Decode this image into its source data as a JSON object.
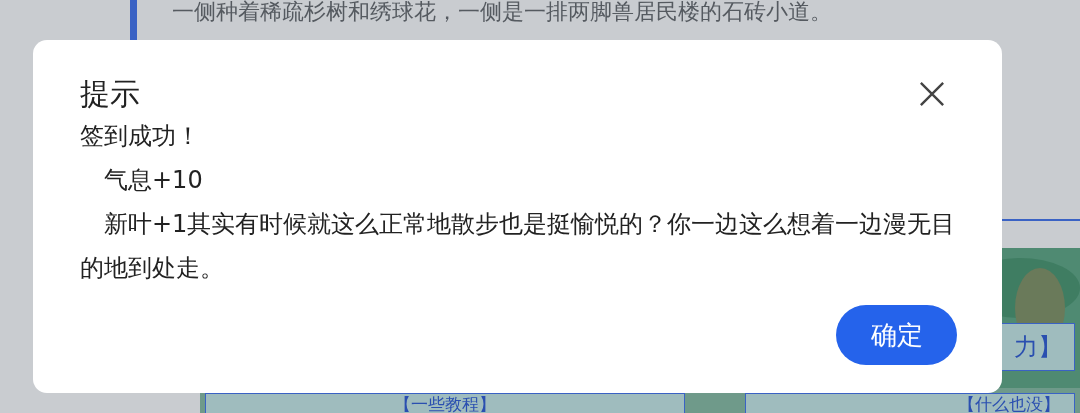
{
  "background": {
    "paragraph": "一侧种着稀疏杉树和绣球花，一侧是一排两脚兽居民楼的石砖小道。",
    "buttons": [
      "力】",
      "【一些教程】",
      "【什么也没】"
    ]
  },
  "dialog": {
    "title": "提示",
    "lines": [
      "签到成功！",
      "　气息+10",
      "　新叶+1其实有时候就这么正常地散步也是挺愉悦的？你一边这么想着一边漫无目的地到处走。"
    ],
    "confirm": "确定"
  }
}
